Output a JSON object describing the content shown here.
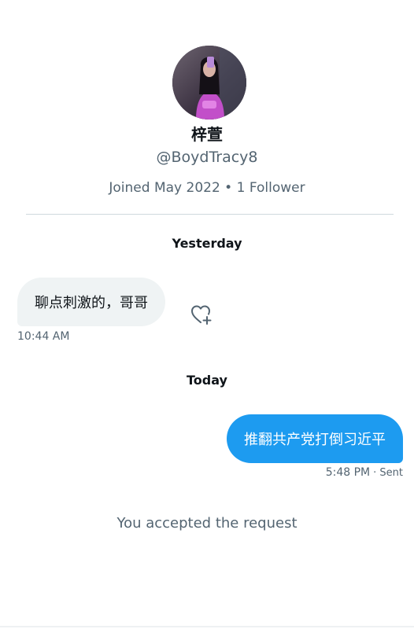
{
  "profile": {
    "display_name": "梓萱",
    "handle": "@BoydTracy8",
    "meta": "Joined May 2022 • 1 Follower",
    "avatar_icon": "profile-photo"
  },
  "conversation": {
    "day_labels": [
      "Yesterday",
      "Today"
    ],
    "messages": [
      {
        "direction": "received",
        "text": "聊点刺激的，哥哥",
        "time": "10:44 AM",
        "reaction_icon": "heart-plus-icon"
      },
      {
        "direction": "sent",
        "text": "推翻共产党打倒习近平",
        "time": "5:48 PM",
        "status": "· Sent"
      }
    ],
    "system_note": "You accepted the request"
  },
  "colors": {
    "accent": "#1d9bf0",
    "received_bubble": "#eff3f4",
    "secondary_text": "#536471",
    "primary_text": "#0f1419"
  }
}
